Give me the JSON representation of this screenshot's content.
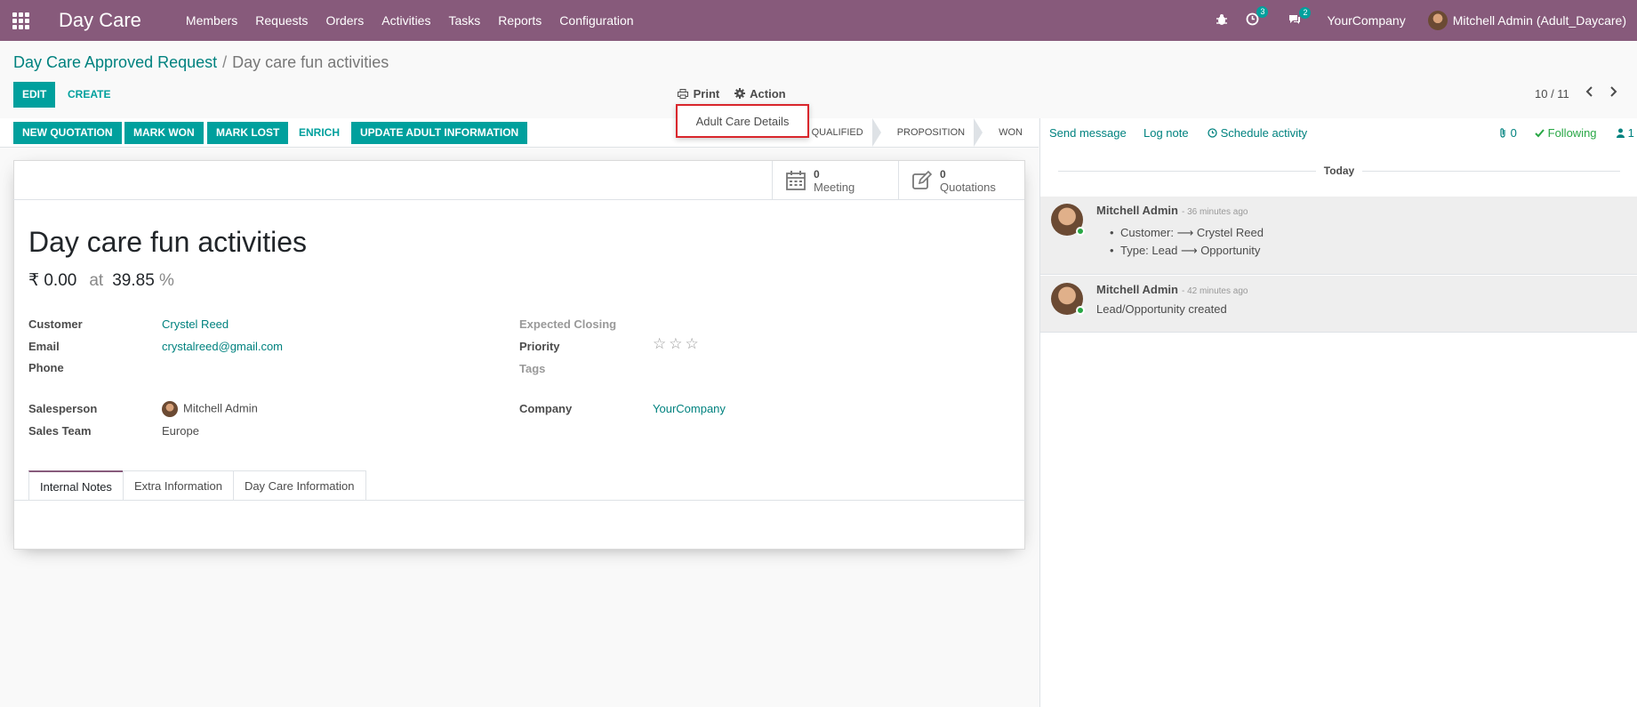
{
  "navbar": {
    "app_name": "Day Care",
    "menu": [
      "Members",
      "Requests",
      "Orders",
      "Activities",
      "Tasks",
      "Reports",
      "Configuration"
    ],
    "activity_count": "3",
    "message_count": "2",
    "company": "YourCompany",
    "user": "Mitchell Admin (Adult_Daycare)"
  },
  "breadcrumb": {
    "parent": "Day Care Approved Request",
    "separator": "/",
    "current": "Day care fun activities"
  },
  "controls": {
    "edit_label": "EDIT",
    "create_label": "CREATE",
    "print_label": "Print",
    "action_label": "Action",
    "pager": "10 / 11",
    "dropdown_item": "Adult Care Details"
  },
  "statusbar": {
    "buttons": [
      "NEW QUOTATION",
      "MARK WON",
      "MARK LOST",
      "ENRICH",
      "UPDATE ADULT INFORMATION"
    ],
    "stages": [
      "QUALIFIED",
      "PROPOSITION",
      "WON"
    ]
  },
  "buttonbox": {
    "meeting_count": "0",
    "meeting_label": "Meeting",
    "quotation_count": "0",
    "quotation_label": "Quotations"
  },
  "form": {
    "title": "Day care fun activities",
    "revenue": "₹ 0.00",
    "at_label": "at",
    "probability": "39.85",
    "pct_sign": "%",
    "labels": {
      "customer": "Customer",
      "email": "Email",
      "phone": "Phone",
      "salesperson": "Salesperson",
      "sales_team": "Sales Team",
      "expected_closing": "Expected Closing",
      "priority": "Priority",
      "tags": "Tags",
      "company": "Company"
    },
    "values": {
      "customer": "Crystel Reed",
      "email": "crystalreed@gmail.com",
      "salesperson": "Mitchell Admin",
      "sales_team": "Europe",
      "company": "YourCompany"
    },
    "priority_stars": "☆☆☆",
    "tabs": [
      "Internal Notes",
      "Extra Information",
      "Day Care Information"
    ]
  },
  "chatter": {
    "send_message": "Send message",
    "log_note": "Log note",
    "schedule_activity": "Schedule activity",
    "attachments": "0",
    "following": "Following",
    "followers": "1",
    "today": "Today",
    "messages": [
      {
        "author": "Mitchell Admin",
        "time": "- 36 minutes ago",
        "lines": [
          "Customer: ⟶ Crystel Reed",
          "Type: Lead ⟶ Opportunity"
        ]
      },
      {
        "author": "Mitchell Admin",
        "time": "- 42 minutes ago",
        "lines": [
          "Lead/Opportunity created"
        ]
      }
    ]
  },
  "colors": {
    "navbar": "#875a7b",
    "primary": "#00a09d",
    "link": "#00827f",
    "highlight_border": "#d9262c"
  }
}
